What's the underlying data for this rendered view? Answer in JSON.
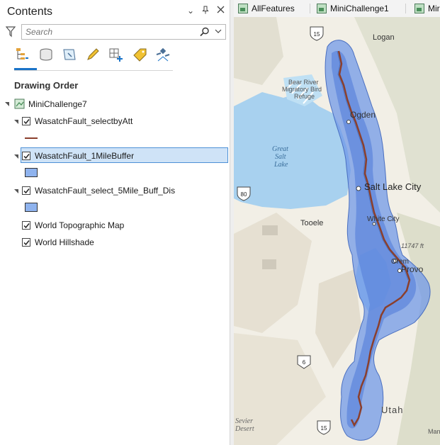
{
  "contents_pane": {
    "title": "Contents",
    "search_placeholder": "Search",
    "section_heading": "Drawing Order",
    "map_name": "MiniChallenge7",
    "layers": [
      {
        "name": "WasatchFault_selectbyAtt",
        "checked": true,
        "symbol": "line",
        "color": "#8b3f2c"
      },
      {
        "name": "WasatchFault_1MileBuffer",
        "checked": true,
        "symbol": "polygon",
        "color": "#8fb3ee",
        "selected": true
      },
      {
        "name": "WasatchFault_select_5Mile_Buff_Dis",
        "checked": true,
        "symbol": "polygon",
        "color": "#8fb3ee"
      },
      {
        "name": "World Topographic Map",
        "checked": true
      },
      {
        "name": "World Hillshade",
        "checked": true
      }
    ]
  },
  "map_view": {
    "tabs": [
      {
        "label": "AllFeatures"
      },
      {
        "label": "MiniChallenge1"
      },
      {
        "label": "Mir"
      }
    ],
    "labels": {
      "logan": "Logan",
      "bear_river": "Bear River",
      "migratory": "Migratory Bird",
      "refuge": "Refuge",
      "ogden": "Ogden",
      "great": "Great",
      "salt": "Salt",
      "lake": "Lake",
      "slc": "Salt Lake City",
      "tooele": "Tooele",
      "white_city": "White City",
      "elev": "11747 ft",
      "orem": "Orem",
      "provo": "Provo",
      "utah": "Utah",
      "sevier": "Sevier",
      "desert": "Desert",
      "man": "Man"
    },
    "shields": {
      "i15_top": "15",
      "i80": "80",
      "us6": "6",
      "i15_bottom": "15"
    },
    "colors": {
      "buffer": "#6c96e8",
      "fault": "#8b3f2c",
      "lake": "#a8d1ef",
      "land": "#f4f1ea"
    }
  }
}
